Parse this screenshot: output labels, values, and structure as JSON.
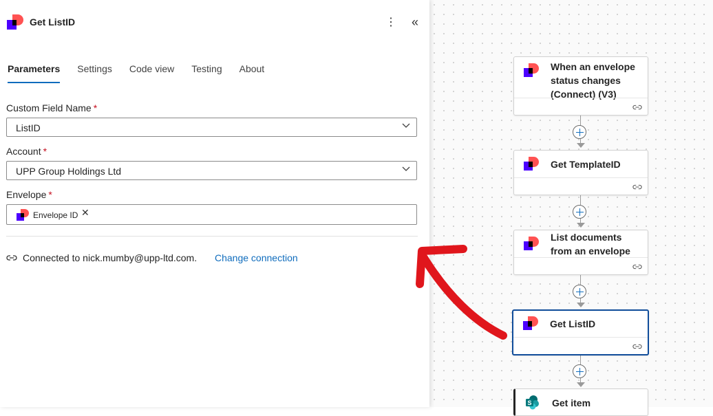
{
  "panel": {
    "title": "Get ListID",
    "more_icon": "more-vertical-icon",
    "collapse_icon": "double-chevron-left-icon",
    "tabs": [
      {
        "label": "Parameters",
        "active": true
      },
      {
        "label": "Settings",
        "active": false
      },
      {
        "label": "Code view",
        "active": false
      },
      {
        "label": "Testing",
        "active": false
      },
      {
        "label": "About",
        "active": false
      }
    ],
    "custom_field": {
      "label": "Custom Field Name",
      "required_mark": "*",
      "value": "ListID"
    },
    "account": {
      "label": "Account",
      "required_mark": "*",
      "value": "UPP Group Holdings Ltd"
    },
    "envelope": {
      "label": "Envelope",
      "required_mark": "*",
      "token": "Envelope ID",
      "remove": "✕"
    },
    "connection": {
      "text": "Connected to nick.mumby@upp-ltd.com.",
      "change_link": "Change connection"
    }
  },
  "flow": {
    "steps": [
      {
        "title": "When an envelope status changes (Connect) (V3)",
        "icon": "docusign-icon"
      },
      {
        "title": "Get TemplateID",
        "icon": "docusign-icon"
      },
      {
        "title": "List documents from an envelope",
        "icon": "docusign-icon"
      },
      {
        "title": "Get ListID",
        "icon": "docusign-icon",
        "selected": true
      },
      {
        "title": "Get item",
        "icon": "sharepoint-icon"
      }
    ]
  },
  "colors": {
    "accent": "#0f6cbd",
    "required": "#c50f1f",
    "annotation_arrow": "#e0161c",
    "docusign_red": "#ff5252",
    "docusign_purple": "#4c00ff"
  }
}
